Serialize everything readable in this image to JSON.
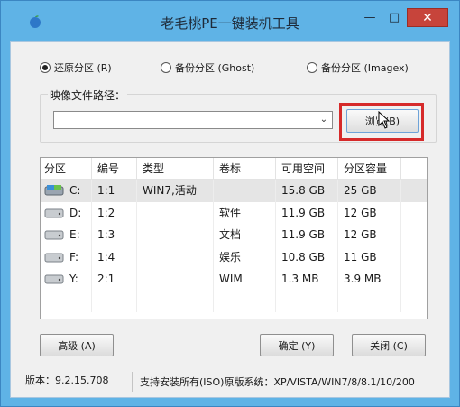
{
  "window": {
    "title": "老毛桃PE一键装机工具",
    "min_glyph": "—",
    "max_glyph": "□",
    "close_glyph": "✕",
    "accent": "#5fb3e6",
    "close_color": "#c7443b"
  },
  "mode": {
    "options": [
      {
        "label": "还原分区 (R)",
        "selected": true
      },
      {
        "label": "备份分区 (Ghost)",
        "selected": false
      },
      {
        "label": "备份分区 (Imagex)",
        "selected": false
      }
    ]
  },
  "image_path": {
    "label": "映像文件路径：",
    "value": "",
    "browse_label": "浏览(B)"
  },
  "partitions": {
    "headers": [
      "分区",
      "编号",
      "类型",
      "卷标",
      "可用空间",
      "分区容量",
      ""
    ],
    "rows": [
      {
        "drive": "C:",
        "num": "1:1",
        "type": "WIN7,活动",
        "label": "",
        "free": "15.8 GB",
        "size": "25 GB",
        "selected": true
      },
      {
        "drive": "D:",
        "num": "1:2",
        "type": "",
        "label": "软件",
        "free": "11.9 GB",
        "size": "12 GB",
        "selected": false
      },
      {
        "drive": "E:",
        "num": "1:3",
        "type": "",
        "label": "文档",
        "free": "11.9 GB",
        "size": "12 GB",
        "selected": false
      },
      {
        "drive": "F:",
        "num": "1:4",
        "type": "",
        "label": "娱乐",
        "free": "10.8 GB",
        "size": "11 GB",
        "selected": false
      },
      {
        "drive": "Y:",
        "num": "2:1",
        "type": "",
        "label": "WIM",
        "free": "1.3 MB",
        "size": "3.9 MB",
        "selected": false
      },
      {
        "drive": "",
        "num": "",
        "type": "",
        "label": "",
        "free": "",
        "size": "",
        "selected": false
      }
    ]
  },
  "buttons": {
    "advanced": "高级 (A)",
    "ok": "确定 (Y)",
    "close": "关闭 (C)"
  },
  "status": {
    "version": "版本：9.2.15.708",
    "support": "支持安装所有(ISO)原版系统：XP/VISTA/WIN7/8/8.1/10/200"
  }
}
